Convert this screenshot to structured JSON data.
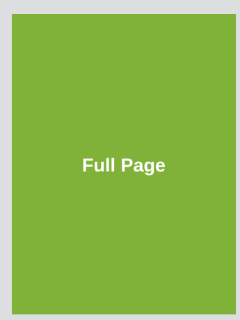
{
  "layout_option": {
    "label": "Full Page",
    "background_color": "#dcdedf",
    "card_color": "#80b139",
    "text_color": "#ffffff"
  }
}
